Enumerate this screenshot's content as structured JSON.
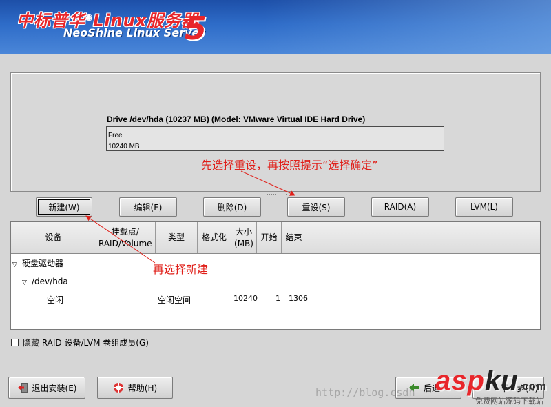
{
  "header": {
    "brand_cn": "中标普华",
    "brand_linux": "Linux服务器",
    "brand_en": "NeoShine Linux Server",
    "brand_number": "5"
  },
  "drive": {
    "title": "Drive /dev/hda (10237 MB) (Model: VMware Virtual IDE Hard Drive)",
    "segment_label": "Free",
    "segment_size": "10240 MB"
  },
  "actions": {
    "new": "新建(W)",
    "edit": "编辑(E)",
    "delete": "删除(D)",
    "reset": "重设(S)",
    "raid": "RAID(A)",
    "lvm": "LVM(L)"
  },
  "table": {
    "headers": [
      "设备",
      "挂载点/\nRAID/Volume",
      "类型",
      "格式化",
      "大小\n(MB)",
      "开始",
      "结束"
    ],
    "tree": {
      "root": "硬盘驱动器",
      "device": "/dev/hda"
    },
    "rows": [
      {
        "device": "空闲",
        "mount": "",
        "type": "空闲空间",
        "format": "",
        "size": "10240",
        "start": "1",
        "end": "1306"
      }
    ]
  },
  "hide_raid_checkbox": {
    "label": "隐藏 RAID 设备/LVM 卷组成员(G)",
    "checked": false
  },
  "bottom": {
    "exit": "退出安装(E)",
    "help": "帮助(H)",
    "back": "后退",
    "next": "下一步(N)"
  },
  "annotations": {
    "first": "先选择重设，再按照提示“选择确定”",
    "second": "再选择新建",
    "color": "#e0201a"
  },
  "watermark": {
    "url": "http://blog.csdn",
    "brand": "asp",
    "brand_suffix": "ku",
    "tld": ".com",
    "sub": "免费网站源码下载站"
  }
}
